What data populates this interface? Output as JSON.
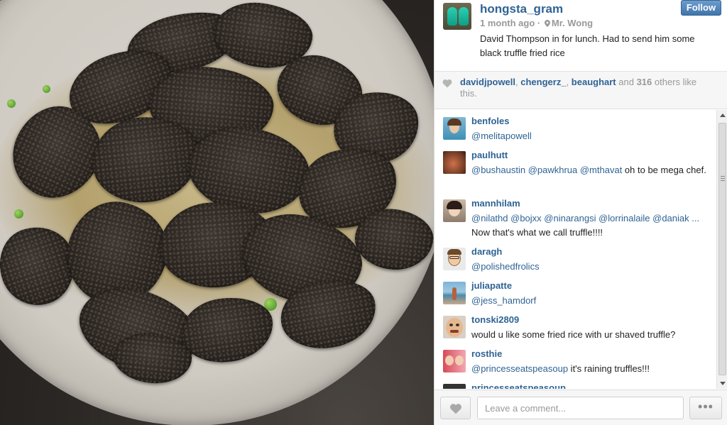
{
  "post": {
    "owner": "hongsta_gram",
    "follow_label": "Follow",
    "time_ago": "1 month ago",
    "separator": "·",
    "location": "Mr. Wong",
    "caption": "David Thompson in for lunch. Had to send him some black truffle fried rice"
  },
  "likes": {
    "users": [
      "davidjpowell",
      "chengerz_",
      "beaughart"
    ],
    "sep1": ", ",
    "sep2": ", ",
    "and": " and ",
    "others_count": "316",
    "suffix": " others like this."
  },
  "comments": [
    {
      "user": "benfoles",
      "mentions": "@melitapowell",
      "text": ""
    },
    {
      "user": "paulhutt",
      "mentions": "@bushaustin @pawkhrua @mthavat",
      "text": " oh to be mega chef."
    },
    {
      "user": "mannhilam",
      "mentions": "@nilathd @bojxx @ninarangsi @lorrinalaile @daniak ...",
      "text": "Now that's what we call truffle!!!!"
    },
    {
      "user": "daragh",
      "mentions": "@polishedfrolics",
      "text": ""
    },
    {
      "user": "juliapatte",
      "mentions": "@jess_hamdorf",
      "text": ""
    },
    {
      "user": "tonski2809",
      "mentions": "",
      "text": "would u like some fried rice with ur shaved truffle?"
    },
    {
      "user": "rosthie",
      "mentions": "@princesseatspeasoup",
      "text": " it's raining truffles!!!"
    },
    {
      "user": "princesseatspeasoup",
      "mentions": "",
      "text": ""
    }
  ],
  "footer": {
    "comment_placeholder": "Leave a comment...",
    "more_label": "•••"
  },
  "colors": {
    "link": "#2f6394",
    "follow_button": "#4a7fb5",
    "muted": "#999999"
  },
  "icons": {
    "like": "heart-icon",
    "location": "location-pin-icon",
    "more": "ellipsis-icon"
  }
}
